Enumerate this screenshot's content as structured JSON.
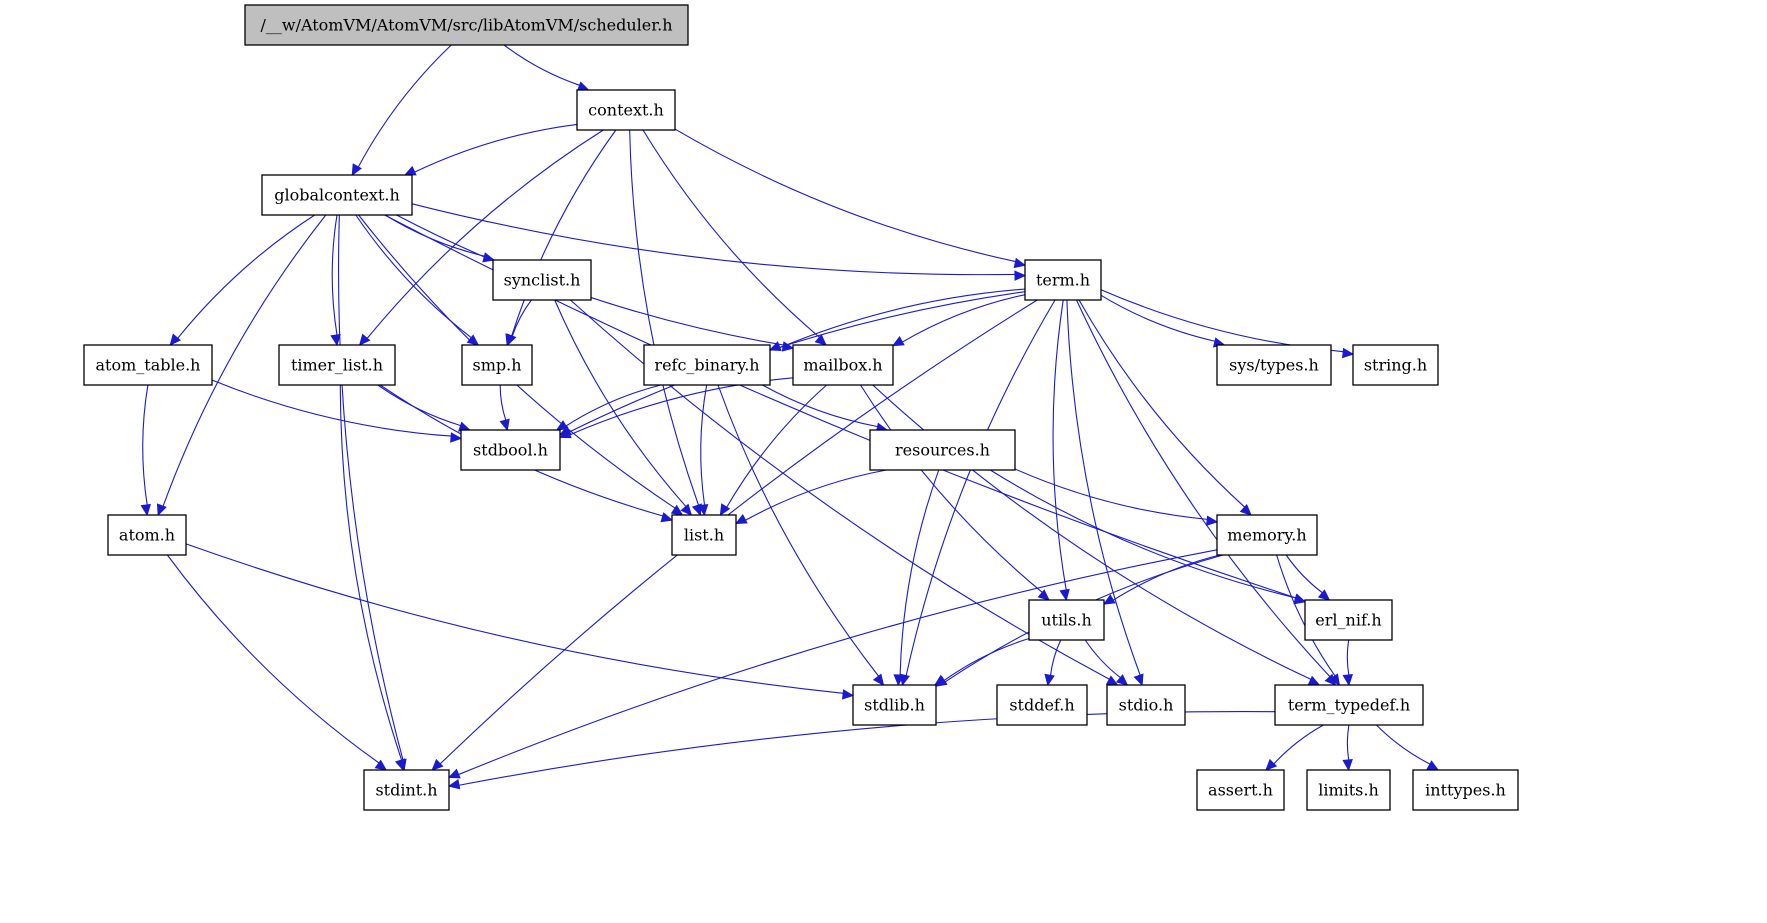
{
  "diagram": {
    "type": "include-dependency-graph",
    "root": "/__w/AtomVM/AtomVM/src/libAtomVM/scheduler.h",
    "colors": {
      "edge": "#1a1ad0",
      "root_fill": "#bfbfbf",
      "node_fill": "#ffffff",
      "node_border": "#000000"
    },
    "nodes": [
      {
        "id": "scheduler",
        "label": "/__w/AtomVM/AtomVM/src/libAtomVM/scheduler.h",
        "root": true
      },
      {
        "id": "context",
        "label": "context.h"
      },
      {
        "id": "globalcontext",
        "label": "globalcontext.h"
      },
      {
        "id": "term",
        "label": "term.h"
      },
      {
        "id": "synclist",
        "label": "synclist.h"
      },
      {
        "id": "atom_table",
        "label": "atom_table.h"
      },
      {
        "id": "timer_list",
        "label": "timer_list.h"
      },
      {
        "id": "smp",
        "label": "smp.h"
      },
      {
        "id": "refc_binary",
        "label": "refc_binary.h"
      },
      {
        "id": "mailbox",
        "label": "mailbox.h"
      },
      {
        "id": "sys_types",
        "label": "sys/types.h"
      },
      {
        "id": "string",
        "label": "string.h"
      },
      {
        "id": "stdbool",
        "label": "stdbool.h"
      },
      {
        "id": "resources",
        "label": "resources.h"
      },
      {
        "id": "atom",
        "label": "atom.h"
      },
      {
        "id": "list",
        "label": "list.h"
      },
      {
        "id": "memory",
        "label": "memory.h"
      },
      {
        "id": "utils",
        "label": "utils.h"
      },
      {
        "id": "erl_nif",
        "label": "erl_nif.h"
      },
      {
        "id": "stdlib",
        "label": "stdlib.h"
      },
      {
        "id": "stddef",
        "label": "stddef.h"
      },
      {
        "id": "stdio",
        "label": "stdio.h"
      },
      {
        "id": "term_typedef",
        "label": "term_typedef.h"
      },
      {
        "id": "stdint",
        "label": "stdint.h"
      },
      {
        "id": "assert",
        "label": "assert.h"
      },
      {
        "id": "limits",
        "label": "limits.h"
      },
      {
        "id": "inttypes",
        "label": "inttypes.h"
      }
    ],
    "edges": [
      [
        "scheduler",
        "globalcontext"
      ],
      [
        "scheduler",
        "context"
      ],
      [
        "context",
        "globalcontext"
      ],
      [
        "context",
        "timer_list"
      ],
      [
        "context",
        "smp"
      ],
      [
        "context",
        "mailbox"
      ],
      [
        "context",
        "list"
      ],
      [
        "context",
        "term"
      ],
      [
        "globalcontext",
        "stdint"
      ],
      [
        "globalcontext",
        "atom"
      ],
      [
        "globalcontext",
        "atom_table"
      ],
      [
        "globalcontext",
        "list"
      ],
      [
        "globalcontext",
        "timer_list"
      ],
      [
        "globalcontext",
        "smp"
      ],
      [
        "globalcontext",
        "synclist"
      ],
      [
        "globalcontext",
        "mailbox"
      ],
      [
        "globalcontext",
        "term"
      ],
      [
        "globalcontext",
        "erl_nif"
      ],
      [
        "synclist",
        "smp"
      ],
      [
        "synclist",
        "list"
      ],
      [
        "synclist",
        "stdio"
      ],
      [
        "term",
        "stdbool"
      ],
      [
        "term",
        "stdint"
      ],
      [
        "term",
        "refc_binary"
      ],
      [
        "term",
        "mailbox"
      ],
      [
        "term",
        "stdlib"
      ],
      [
        "term",
        "utils"
      ],
      [
        "term",
        "stdio"
      ],
      [
        "term",
        "sys_types"
      ],
      [
        "term",
        "string"
      ],
      [
        "term",
        "memory"
      ],
      [
        "term",
        "term_typedef"
      ],
      [
        "atom_table",
        "stdbool"
      ],
      [
        "atom_table",
        "atom"
      ],
      [
        "timer_list",
        "stdbool"
      ],
      [
        "timer_list",
        "list"
      ],
      [
        "timer_list",
        "stdint"
      ],
      [
        "smp",
        "stdbool"
      ],
      [
        "refc_binary",
        "stdbool"
      ],
      [
        "refc_binary",
        "list"
      ],
      [
        "refc_binary",
        "resources"
      ],
      [
        "refc_binary",
        "stdlib"
      ],
      [
        "mailbox",
        "stdbool"
      ],
      [
        "mailbox",
        "list"
      ],
      [
        "mailbox",
        "utils"
      ],
      [
        "mailbox",
        "term_typedef"
      ],
      [
        "resources",
        "list"
      ],
      [
        "resources",
        "stdlib"
      ],
      [
        "resources",
        "memory"
      ],
      [
        "resources",
        "erl_nif"
      ],
      [
        "atom",
        "stdint"
      ],
      [
        "atom",
        "stdlib"
      ],
      [
        "memory",
        "stdlib"
      ],
      [
        "memory",
        "utils"
      ],
      [
        "memory",
        "erl_nif"
      ],
      [
        "memory",
        "term_typedef"
      ],
      [
        "memory",
        "stdint"
      ],
      [
        "utils",
        "stdlib"
      ],
      [
        "utils",
        "stddef"
      ],
      [
        "utils",
        "stdio"
      ],
      [
        "erl_nif",
        "term_typedef"
      ],
      [
        "term_typedef",
        "stdint"
      ],
      [
        "term_typedef",
        "assert"
      ],
      [
        "term_typedef",
        "limits"
      ],
      [
        "term_typedef",
        "inttypes"
      ]
    ]
  }
}
